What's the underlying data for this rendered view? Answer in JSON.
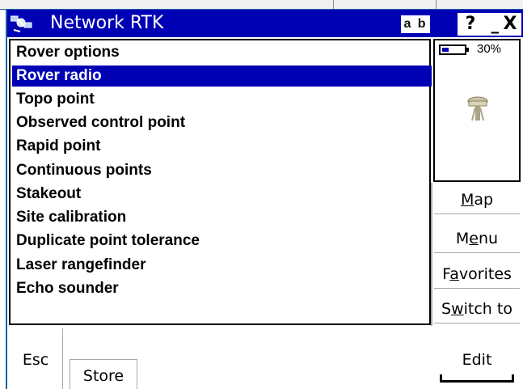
{
  "window": {
    "title": "Network RTK",
    "input_mode": "a b",
    "help_label": "?",
    "minimize_label": "_",
    "close_label": "X"
  },
  "list": {
    "items": [
      {
        "label": "Rover options"
      },
      {
        "label": "Rover radio",
        "selected": true
      },
      {
        "label": "Topo point"
      },
      {
        "label": "Observed control point"
      },
      {
        "label": "Rapid point"
      },
      {
        "label": "Continuous points"
      },
      {
        "label": "Stakeout"
      },
      {
        "label": "Site calibration"
      },
      {
        "label": "Duplicate point tolerance"
      },
      {
        "label": "Laser rangefinder"
      },
      {
        "label": "Echo sounder"
      }
    ]
  },
  "status": {
    "battery_percent": 30,
    "battery_text": "30%",
    "receiver_icon": "gnss-receiver-icon"
  },
  "side_buttons": [
    {
      "pre": "",
      "key": "M",
      "post": "ap"
    },
    {
      "pre": "M",
      "key": "e",
      "post": "nu"
    },
    {
      "pre": "F",
      "key": "a",
      "post": "vorites"
    },
    {
      "pre": "S",
      "key": "w",
      "post": "itch to"
    }
  ],
  "bottom": {
    "esc_label": "Esc",
    "store_label": "Store",
    "edit_label": "Edit"
  },
  "colors": {
    "accent": "#0000b4",
    "border_blue": "#1b5ea6"
  }
}
